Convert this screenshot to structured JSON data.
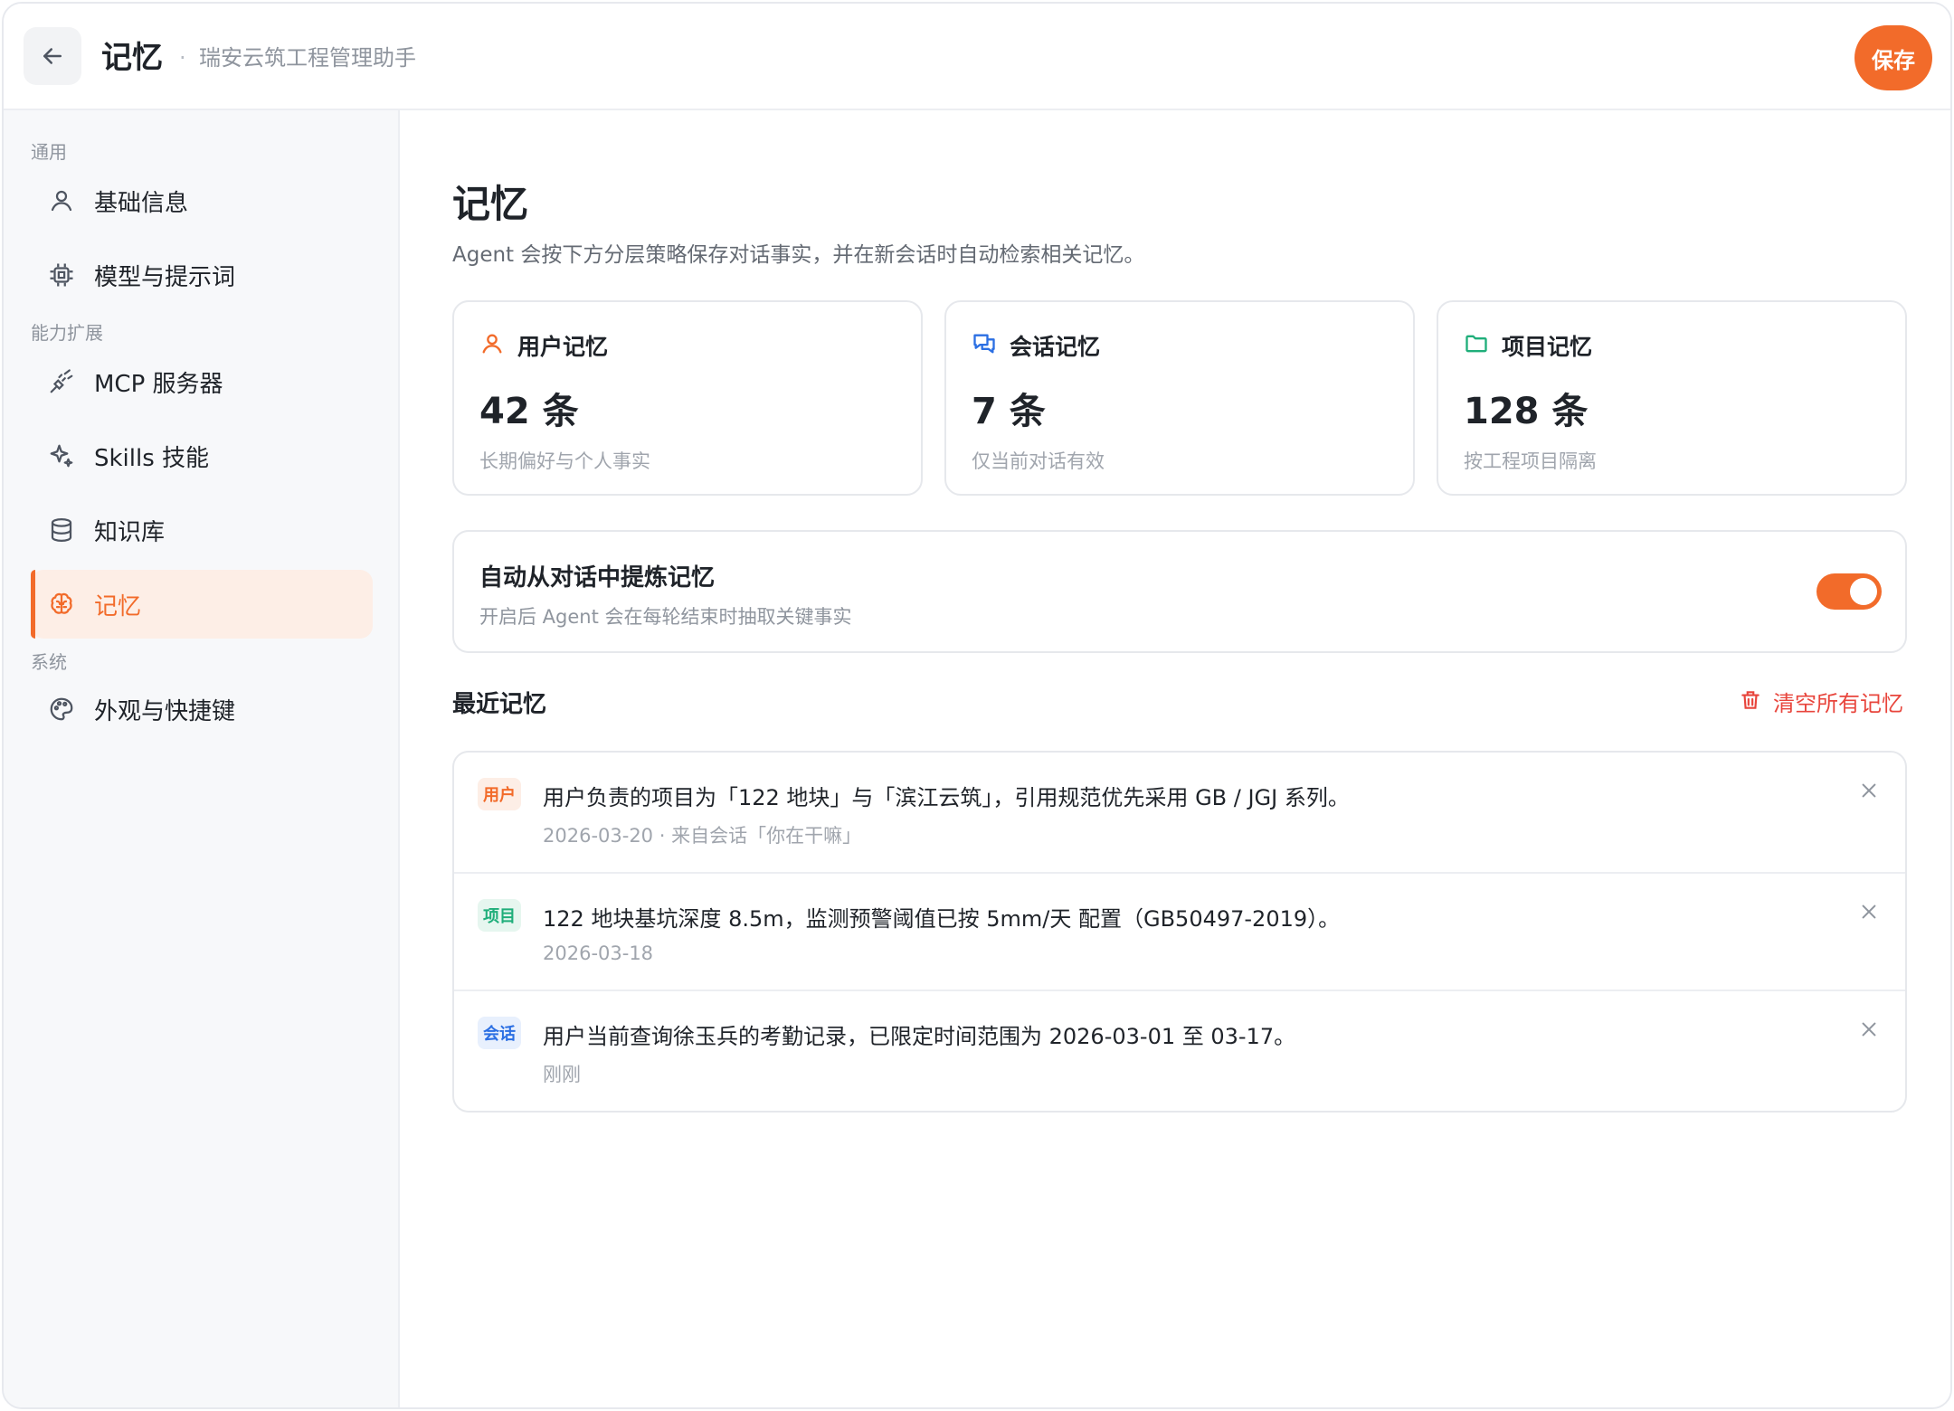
{
  "header": {
    "title": "记忆",
    "separator": "·",
    "subtitle": "瑞安云筑工程管理助手",
    "save_label": "保存"
  },
  "sidebar": {
    "sections": [
      {
        "label": "通用"
      },
      {
        "label": "能力扩展"
      },
      {
        "label": "系统"
      }
    ],
    "items": [
      {
        "label": "基础信息",
        "icon": "user-icon"
      },
      {
        "label": "模型与提示词",
        "icon": "chip-icon"
      },
      {
        "label": "MCP 服务器",
        "icon": "plug-icon"
      },
      {
        "label": "Skills 技能",
        "icon": "sparkles-icon"
      },
      {
        "label": "知识库",
        "icon": "database-icon"
      },
      {
        "label": "记忆",
        "icon": "brain-icon",
        "active": true
      },
      {
        "label": "外观与快捷键",
        "icon": "palette-icon"
      }
    ]
  },
  "main": {
    "title": "记忆",
    "description": "Agent 会按下方分层策略保存对话事实，并在新会话时自动检索相关记忆。",
    "stats": [
      {
        "label": "用户记忆",
        "value": "42 条",
        "note": "长期偏好与个人事实",
        "icon": "user-icon",
        "color": "#f26b2a"
      },
      {
        "label": "会话记忆",
        "value": "7 条",
        "note": "仅当前对话有效",
        "icon": "chat-icon",
        "color": "#2b6fe3"
      },
      {
        "label": "项目记忆",
        "value": "128 条",
        "note": "按工程项目隔离",
        "icon": "folder-icon",
        "color": "#1fae7a"
      }
    ],
    "auto_extract": {
      "title": "自动从对话中提炼记忆",
      "description": "开启后 Agent 会在每轮结束时抽取关键事实",
      "enabled": true
    },
    "recent": {
      "title": "最近记忆",
      "clear_label": "清空所有记忆",
      "items": [
        {
          "tag": "用户",
          "text": "用户负责的项目为「122 地块」与「滨江云筑」，引用规范优先采用 GB / JGJ 系列。",
          "meta": "2026-03-20 · 来自会话「你在干嘛」"
        },
        {
          "tag": "项目",
          "text": "122 地块基坑深度 8.5m，监测预警阈值已按 5mm/天 配置（GB50497-2019）。",
          "meta": "2026-03-18"
        },
        {
          "tag": "会话",
          "text": "用户当前查询徐玉兵的考勤记录，已限定时间范围为 2026-03-01 至 03-17。",
          "meta": "刚刚"
        }
      ]
    }
  },
  "colors": {
    "accent": "#f26b2a",
    "danger": "#e8453c",
    "user_tag": "#f26b2a",
    "project_tag": "#1fae7a",
    "session_tag": "#2b6fe3"
  }
}
